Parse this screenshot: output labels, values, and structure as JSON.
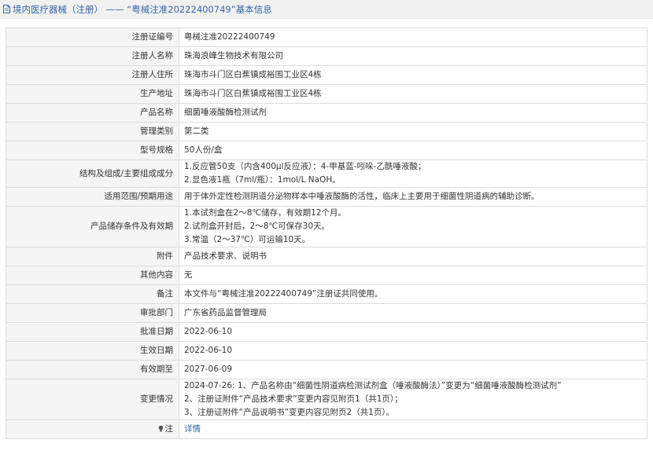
{
  "header": {
    "title": "境内医疗器械（注册） —— “粤械注准20222400749”基本信息"
  },
  "fields": {
    "reg_no": {
      "label": "注册证编号",
      "value": "粤械注准20222400749"
    },
    "registrant": {
      "label": "注册人名称",
      "value": "珠海浪峰生物技术有限公司"
    },
    "registrant_address": {
      "label": "注册人住所",
      "value": "珠海市斗门区白蕉镇成裕围工业区4栋"
    },
    "production_address": {
      "label": "生产地址",
      "value": "珠海市斗门区白蕉镇成裕围工业区4栋"
    },
    "product_name": {
      "label": "产品名称",
      "value": "细菌唾液酸酶检测试剂"
    },
    "category": {
      "label": "管理类别",
      "value": "第二类"
    },
    "model": {
      "label": "型号规格",
      "value": "50人份/盒"
    },
    "structure": {
      "label": "结构及组成/主要组成成分",
      "lines": [
        "1.反应管50支（内含400μl反应液）：4-甲基蓝-吲哚-乙酰唾液酸；",
        "2.显色液1瓶（7ml/瓶）：1mol/L NaOH。"
      ]
    },
    "scope": {
      "label": "适用范围/预期用途",
      "value": "用于体外定性检测阴道分泌物样本中唾液酸酶的活性，临床上主要用于细菌性阴道病的辅助诊断。"
    },
    "storage": {
      "label": "产品储存条件及有效期",
      "lines": [
        "1.本试剂盒在2～8℃储存，有效期12个月。",
        "2.试剂盒开封后，2～8℃可保存30天。",
        "3.常温（2～37℃）可运输10天。"
      ]
    },
    "attachment": {
      "label": "附件",
      "value": "产品技术要求、说明书"
    },
    "other": {
      "label": "其他内容",
      "value": "无"
    },
    "remark": {
      "label": "备注",
      "value": "本文件与“粤械注准20222400749”注册证共同使用。"
    },
    "approval_dept": {
      "label": "审批部门",
      "value": "广东省药品监督管理局"
    },
    "approval_date": {
      "label": "批准日期",
      "value": "2022-06-10"
    },
    "effective_date": {
      "label": "生效日期",
      "value": "2022-06-10"
    },
    "expiry_date": {
      "label": "有效期至",
      "value": "2027-06-09"
    },
    "changes": {
      "label": "变更情况",
      "lines": [
        "2024-07-26: 1、产品名称由“细菌性阴道病检测试剂盒（唾液酸酶法）”变更为“细菌唾液酸酶检测试剂”",
        "2、注册证附件“产品技术要求”变更内容见附页1（共1页）；",
        "3、注册证附件“产品说明书”变更内容见附页2（共1页）。"
      ]
    },
    "detail": {
      "label": "注",
      "link": "详情",
      "icon": "lamp-icon"
    }
  }
}
